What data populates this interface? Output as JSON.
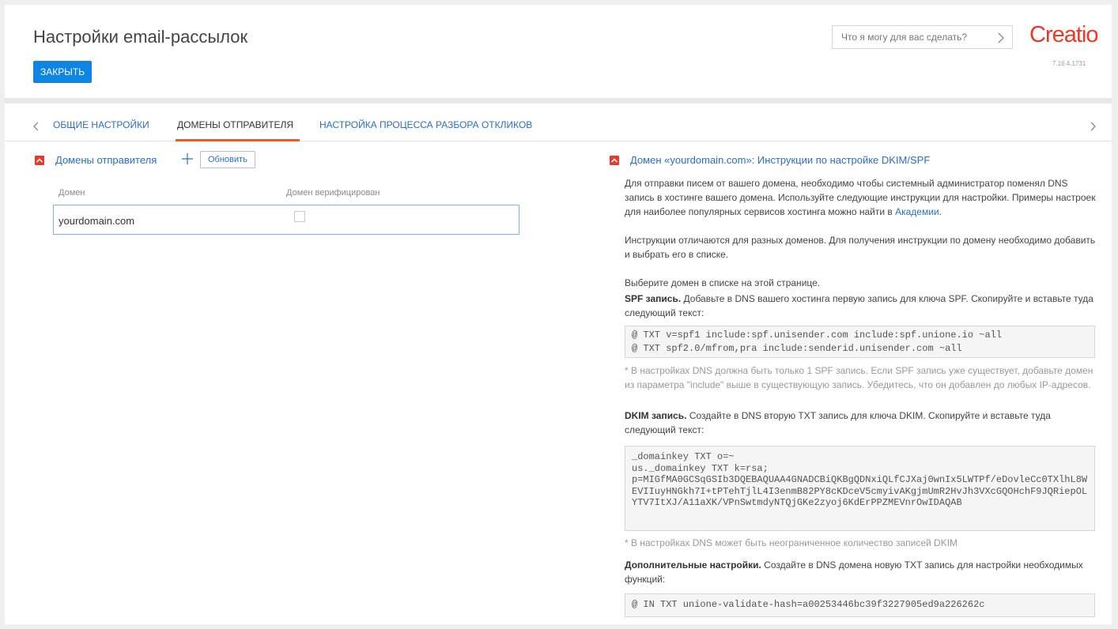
{
  "header": {
    "title": "Настройки email-рассылок",
    "close_label": "ЗАКРЫТЬ",
    "search_placeholder": "Что я могу для вас сделать?",
    "logo_text": "Creatio",
    "version": "7.16.4.1731"
  },
  "tabs": [
    {
      "label": "ОБЩИЕ НАСТРОЙКИ",
      "active": false
    },
    {
      "label": "ДОМЕНЫ ОТПРАВИТЕЛЯ",
      "active": true
    },
    {
      "label": "НАСТРОЙКА ПРОЦЕССА РАЗБОРА ОТКЛИКОВ",
      "active": false
    }
  ],
  "domains_section": {
    "title": "Домены отправителя",
    "refresh_label": "Обновить",
    "columns": [
      "Домен",
      "Домен верифицирован"
    ],
    "rows": [
      {
        "domain": "yourdomain.com",
        "verified": false
      }
    ]
  },
  "instructions": {
    "title": "Домен «yourdomain.com»: Инструкции по настройке DKIM/SPF",
    "intro_1": "Для отправки писем от вашего домена, необходимо чтобы системный администратор поменял DNS запись в хостинге вашего домена. Используйте следующие инструкции для настройки. Примеры настроек для наиболее популярных сервисов хостинга можно найти в ",
    "intro_link": "Академии",
    "intro_end": ".",
    "intro_2": "Инструкции отличаются для разных доменов. Для получения инструкции по домену необходимо добавить и выбрать его в списке.",
    "intro_3": "Выберите домен в списке на этой странице.",
    "spf_bold": "SPF запись.",
    "spf_text": " Добавьте в DNS вашего хостинга первую запись для ключа SPF. Скопируйте и вставьте туда следующий текст:",
    "spf_code_1": "@ TXT v=spf1 include:spf.unisender.com include:spf.unione.io ~all",
    "spf_code_2": "@ TXT spf2.0/mfrom,pra include:senderid.unisender.com ~all",
    "spf_note": "* В настройках DNS должна быть только 1 SPF запись. Если SPF запись уже существует, добавьте домен из параметра \"include\" выше в существующую запись. Убедитесь, что он добавлен до любых IP-адресов.",
    "dkim_bold": "DKIM запись.",
    "dkim_text": " Создайте в DNS вторую TXT запись для ключа DKIM. Скопируйте и вставьте туда следующий текст:",
    "dkim_code_1": "_domainkey TXT o=~",
    "dkim_code_2": "us._domainkey TXT k=rsa;",
    "dkim_code_3": "p=MIGfMA0GCSqGSIb3DQEBAQUAA4GNADCBiQKBgQDNxiQLfCJXaj0wnIx5LWTPf/eDovleCc0TXlhL8WEVIIuyHNGkh7I+tPTehTjlL4I3enmB82PY8cKDceV5cmyivAKgjmUmR2HvJh3VXcGQOHchF9JQRiepOLYTV7ItXJ/A11aXK/VPnSwtmdyNTQjGKe2zyoj6KdErPPZMEVnrOwIDAQAB",
    "dkim_note": "* В настройках DNS может быть неограниченное количество записей DKIM",
    "extra_bold": "Дополнительные настройки.",
    "extra_text": " Создайте в DNS домена новую TXT запись для настройки необходимых функций:",
    "extra_code": "@ IN TXT unione-validate-hash=a00253446bc39f3227905ed9a226262c"
  }
}
